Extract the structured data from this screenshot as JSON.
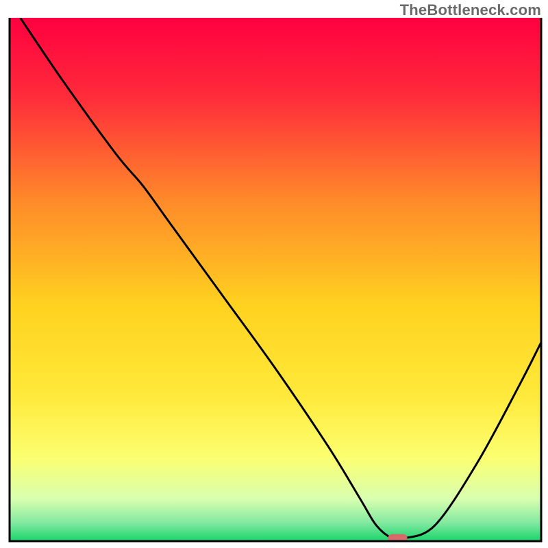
{
  "watermark": "TheBottleneck.com",
  "chart_data": {
    "type": "line",
    "title": "",
    "xlabel": "",
    "ylabel": "",
    "xlim": [
      0,
      100
    ],
    "ylim": [
      0,
      100
    ],
    "grid": false,
    "legend": false,
    "annotations": [],
    "background": {
      "style": "vertical-gradient",
      "stops": [
        {
          "pos": 0.0,
          "color": "#ff0040"
        },
        {
          "pos": 0.15,
          "color": "#ff2b3a"
        },
        {
          "pos": 0.35,
          "color": "#ff8a2a"
        },
        {
          "pos": 0.55,
          "color": "#ffd21f"
        },
        {
          "pos": 0.72,
          "color": "#ffe93a"
        },
        {
          "pos": 0.84,
          "color": "#fcff70"
        },
        {
          "pos": 0.92,
          "color": "#d8ffb0"
        },
        {
          "pos": 0.965,
          "color": "#81e9a0"
        },
        {
          "pos": 1.0,
          "color": "#18d56a"
        }
      ]
    },
    "series": [
      {
        "name": "bottleneck-curve",
        "color": "#000000",
        "x": [
          2,
          10,
          20,
          25,
          30,
          40,
          50,
          60,
          66,
          69,
          72,
          74,
          80,
          88,
          96,
          100
        ],
        "y": [
          100,
          88,
          74,
          68,
          61,
          47,
          33,
          18,
          8,
          3,
          0.5,
          0.5,
          3,
          15,
          30,
          38
        ]
      }
    ],
    "marker": {
      "name": "optimal-point",
      "x": 73,
      "y": 0.5,
      "color": "#d66a6a",
      "shape": "rounded-rect"
    }
  },
  "frame": {
    "style": "three-sided",
    "color": "#000000",
    "thickness_px": 3
  }
}
